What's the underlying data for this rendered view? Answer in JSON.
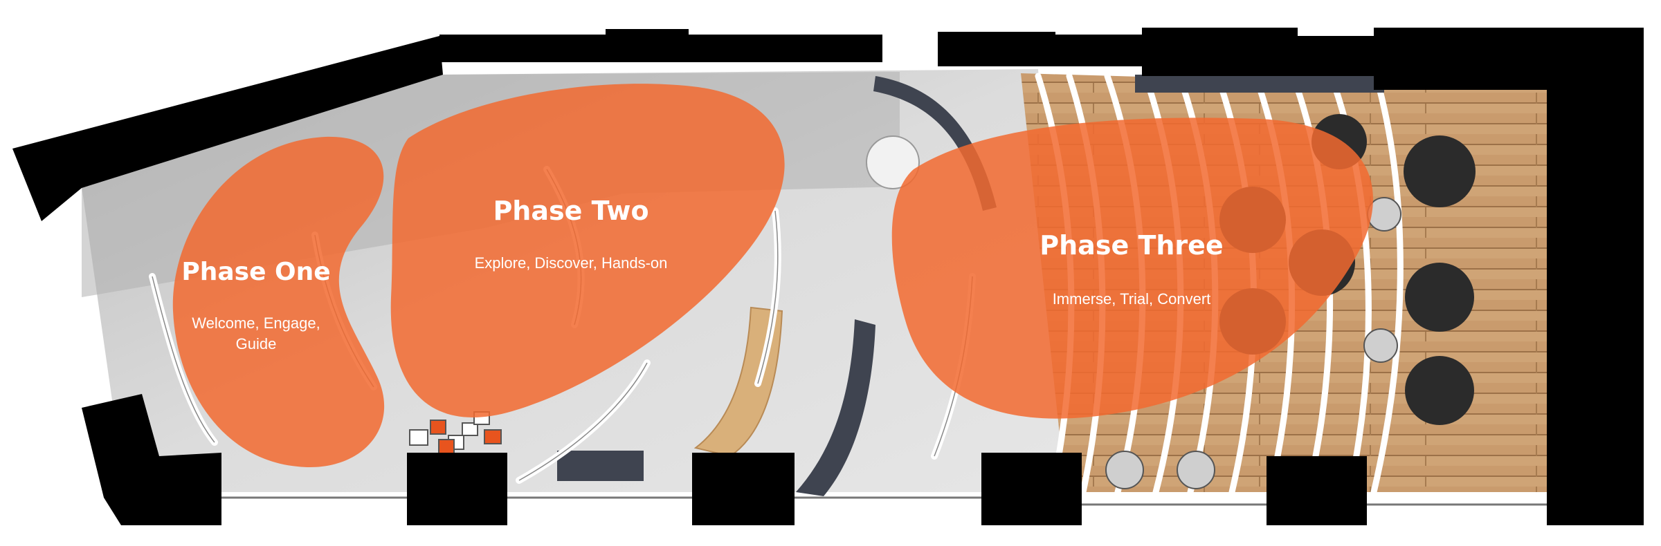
{
  "zones": [
    {
      "name": "phase-one",
      "title": "Phase One",
      "subtitle_lines": [
        "Welcome, Engage,",
        "Guide"
      ]
    },
    {
      "name": "phase-two",
      "title": "Phase Two",
      "subtitle_lines": [
        "Explore, Discover, Hands-on"
      ]
    },
    {
      "name": "phase-three",
      "title": "Phase Three",
      "subtitle_lines": [
        "Immerse, Trial, Convert"
      ]
    }
  ],
  "colors": {
    "zone_fill": "#f26a30",
    "wall": "#000000",
    "floor_concrete": "#d4d4d4",
    "floor_wood": "#c89a6c",
    "bench_dark": "#3f4450",
    "accent_box": "#e8541e"
  }
}
